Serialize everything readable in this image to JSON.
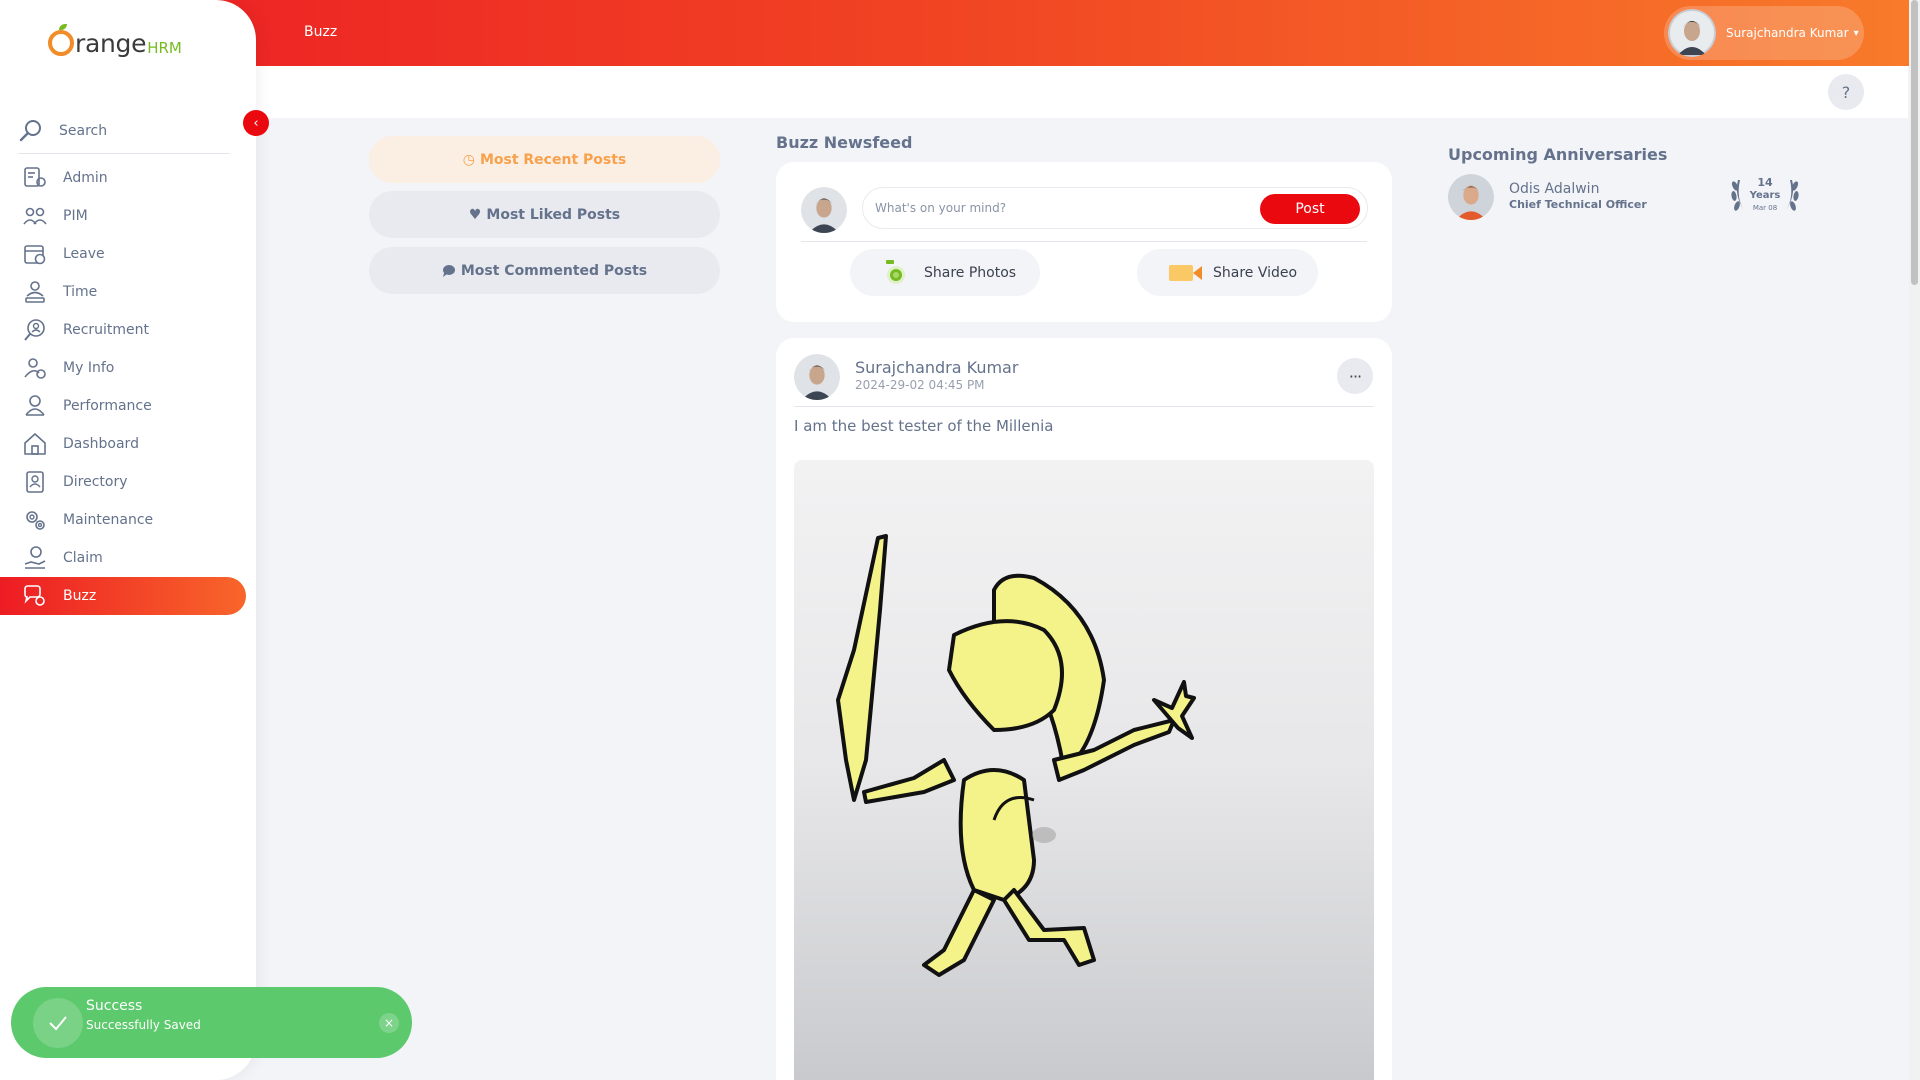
{
  "brand": {
    "word1": "range",
    "word2": "HRM"
  },
  "topbar": {
    "title": "Buzz",
    "user_name": "Surajchandra Kumar",
    "caret": "▾"
  },
  "help": {
    "label": "?"
  },
  "sidebar": {
    "search_label": "Search",
    "collapse_icon": "‹",
    "items": [
      {
        "label": "Admin",
        "icon": "admin-icon"
      },
      {
        "label": "PIM",
        "icon": "pim-icon"
      },
      {
        "label": "Leave",
        "icon": "leave-icon"
      },
      {
        "label": "Time",
        "icon": "time-icon"
      },
      {
        "label": "Recruitment",
        "icon": "recruitment-icon"
      },
      {
        "label": "My Info",
        "icon": "myinfo-icon"
      },
      {
        "label": "Performance",
        "icon": "performance-icon"
      },
      {
        "label": "Dashboard",
        "icon": "dashboard-icon"
      },
      {
        "label": "Directory",
        "icon": "directory-icon"
      },
      {
        "label": "Maintenance",
        "icon": "maintenance-icon"
      },
      {
        "label": "Claim",
        "icon": "claim-icon"
      },
      {
        "label": "Buzz",
        "icon": "buzz-icon",
        "active": true
      }
    ]
  },
  "filters": [
    {
      "label": "Most Recent Posts",
      "icon": "clock-icon",
      "active": true
    },
    {
      "label": "Most Liked Posts",
      "icon": "heart-icon"
    },
    {
      "label": "Most Commented Posts",
      "icon": "comment-icon"
    }
  ],
  "newsfeed": {
    "title": "Buzz Newsfeed",
    "input_placeholder": "What's on your mind?",
    "post_button": "Post",
    "share_photos": "Share Photos",
    "share_video": "Share Video"
  },
  "post": {
    "author": "Surajchandra Kumar",
    "timestamp": "2024-29-02 04:45 PM",
    "text": "I am the best tester of the Millenia",
    "more_icon": "···"
  },
  "anniversaries": {
    "title": "Upcoming Anniversaries",
    "items": [
      {
        "name": "Odis Adalwin",
        "job_title": "Chief Technical Officer",
        "years_number": "14",
        "years_label": "Years",
        "date": "Mar 08"
      }
    ]
  },
  "toast": {
    "title": "Success",
    "message": "Successfully Saved",
    "close": "×"
  },
  "colors": {
    "accent": "#eb0910",
    "brand_orange": "#f28c28",
    "brand_green": "#76bc21",
    "success": "#5cc96c",
    "text": "#64728c"
  }
}
